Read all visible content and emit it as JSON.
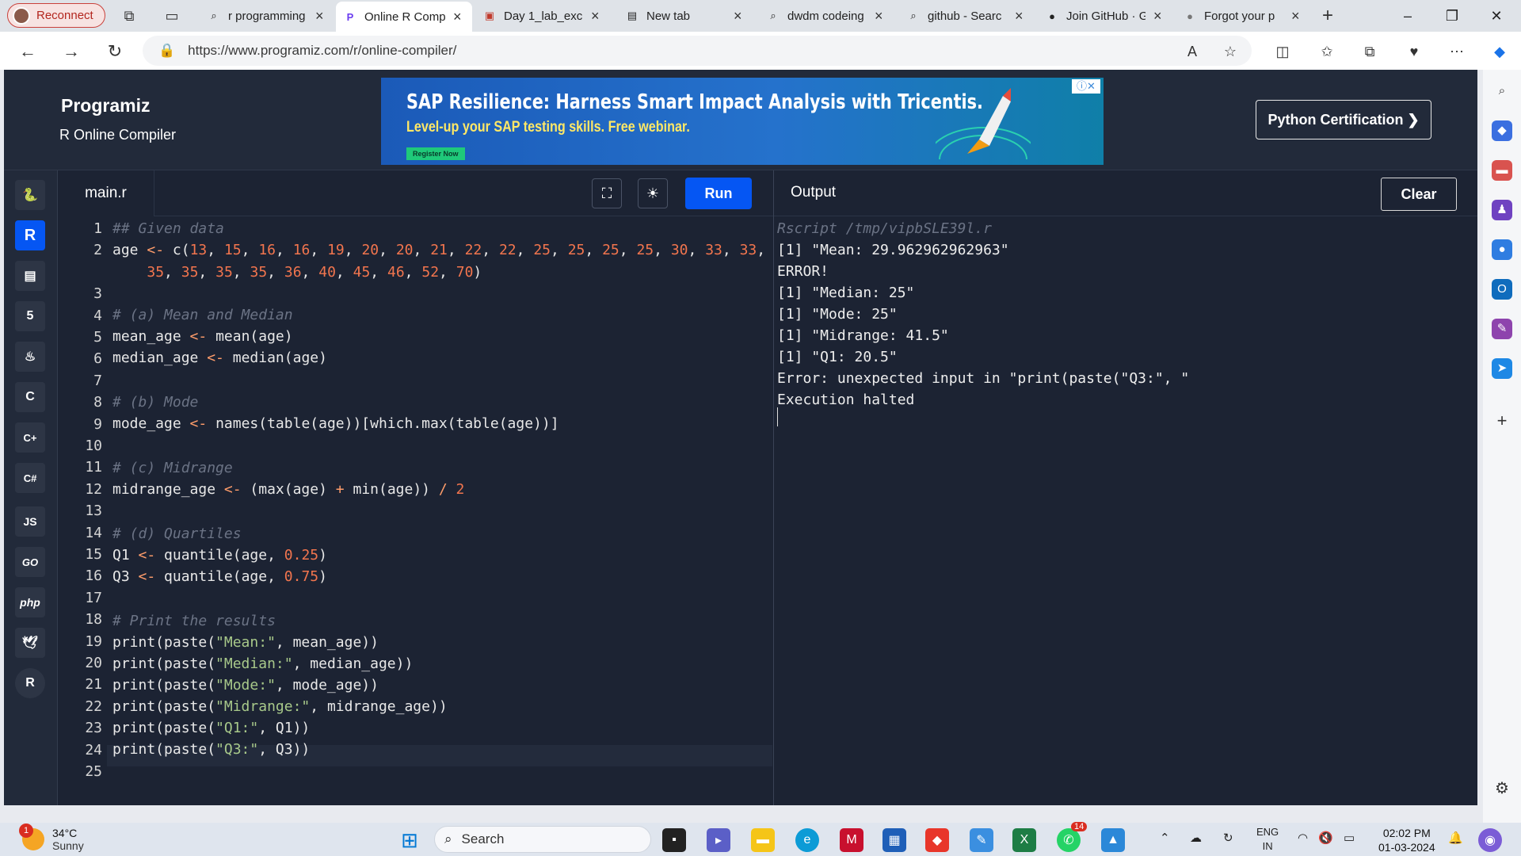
{
  "browser": {
    "reconnect_label": "Reconnect",
    "tabs": [
      {
        "label": "r programming",
        "icon": "search-icon"
      },
      {
        "label": "Online R Comp",
        "icon": "programiz-icon",
        "active": true
      },
      {
        "label": "Day 1_lab_exc",
        "icon": "pdf-icon"
      },
      {
        "label": "New tab",
        "icon": "newtab-icon"
      },
      {
        "label": "dwdm codeing",
        "icon": "search-icon"
      },
      {
        "label": "github - Searc",
        "icon": "search-icon"
      },
      {
        "label": "Join GitHub · G",
        "icon": "github-icon"
      },
      {
        "label": "Forgot your p",
        "icon": "github-icon"
      }
    ],
    "url": "https://www.programiz.com/r/online-compiler/"
  },
  "header": {
    "logo": "Programiz",
    "subtitle": "R Online Compiler",
    "ad_headline": "SAP Resilience: Harness Smart Impact Analysis with Tricentis.",
    "ad_subline": "Level-up your SAP testing skills. Free webinar.",
    "ad_cta": "Register Now",
    "cert_button": "Python Certification ❯"
  },
  "languages": [
    {
      "name": "python-icon",
      "glyph": "🐍"
    },
    {
      "name": "r-icon",
      "glyph": "R",
      "active": true
    },
    {
      "name": "sql-icon",
      "glyph": "▤"
    },
    {
      "name": "html5-icon",
      "glyph": "5"
    },
    {
      "name": "java-icon",
      "glyph": "♨"
    },
    {
      "name": "c-icon",
      "glyph": "C"
    },
    {
      "name": "cpp-icon",
      "glyph": "C+"
    },
    {
      "name": "csharp-icon",
      "glyph": "C#"
    },
    {
      "name": "js-icon",
      "glyph": "JS"
    },
    {
      "name": "go-icon",
      "glyph": "GO"
    },
    {
      "name": "php-icon",
      "glyph": "php"
    },
    {
      "name": "swift-icon",
      "glyph": "🕊"
    },
    {
      "name": "rust-icon",
      "glyph": "R"
    }
  ],
  "editor": {
    "filename": "main.r",
    "run_label": "Run",
    "line_numbers": [
      "1",
      "2",
      "",
      "3",
      "4",
      "5",
      "6",
      "7",
      "8",
      "9",
      "10",
      "11",
      "12",
      "13",
      "14",
      "15",
      "16",
      "17",
      "18",
      "19",
      "20",
      "21",
      "22",
      "23",
      "24",
      "25"
    ]
  },
  "output": {
    "title": "Output",
    "clear_label": "Clear",
    "lines": [
      "Rscript /tmp/vipbSLE39l.r",
      "[1] \"Mean: 29.962962962963\"",
      "ERROR!",
      "[1] \"Median: 25\"",
      "[1] \"Mode: 25\"",
      "[1] \"Midrange: 41.5\"",
      "[1] \"Q1: 20.5\"",
      "Error: unexpected input in \"print(paste(\"Q3:\", \"",
      "Execution halted"
    ]
  },
  "taskbar": {
    "temp": "34°C",
    "weather": "Sunny",
    "weather_badge": "1",
    "search_label": "Search",
    "whatsapp_badge": "14",
    "lang": "ENG",
    "region": "IN",
    "time": "02:02 PM",
    "date": "01-03-2024"
  }
}
